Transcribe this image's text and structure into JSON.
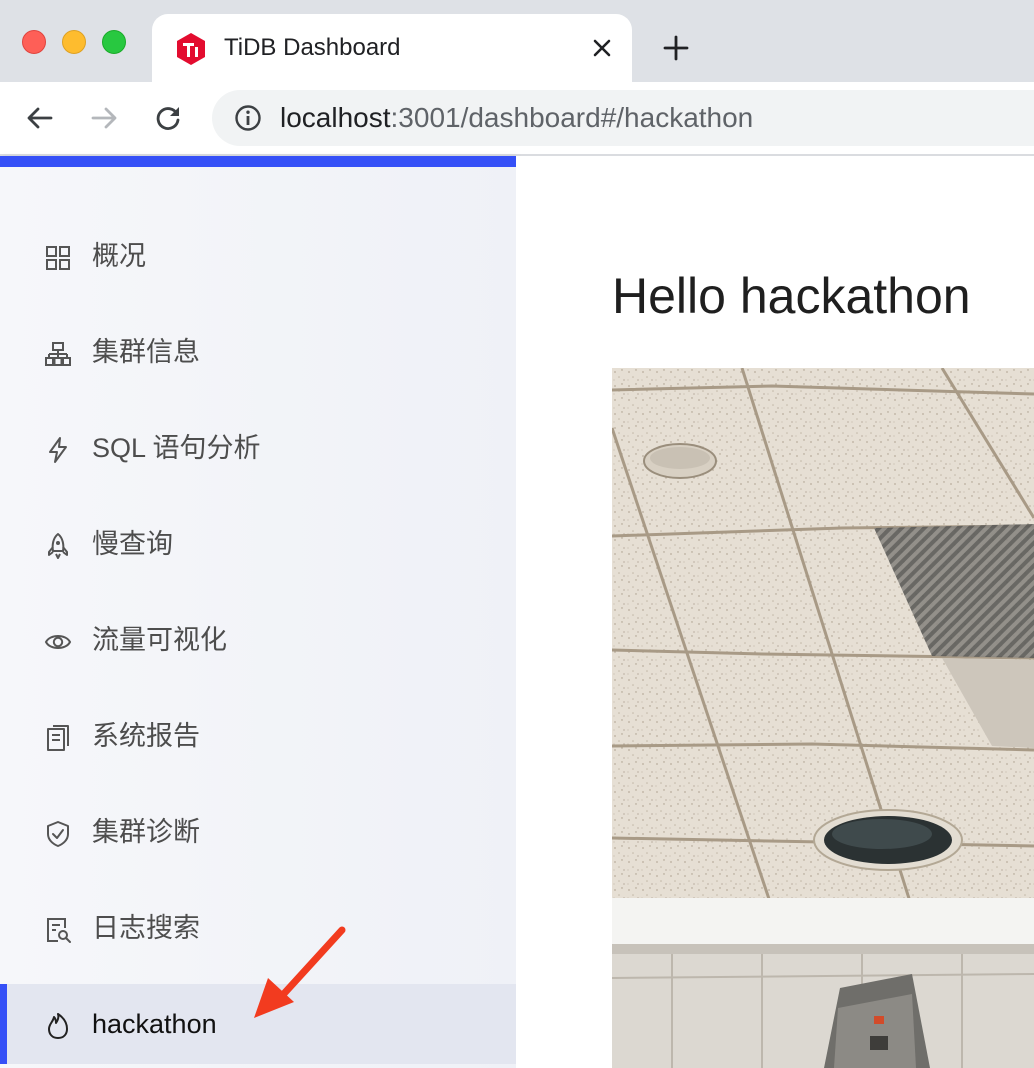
{
  "browser": {
    "tab_title": "TiDB Dashboard",
    "url_host": "localhost",
    "url_rest": ":3001/dashboard#/hackathon"
  },
  "sidebar": {
    "items": [
      {
        "label": "概况",
        "icon": "dashboard-grid-icon"
      },
      {
        "label": "集群信息",
        "icon": "cluster-icon"
      },
      {
        "label": "SQL 语句分析",
        "icon": "thunderbolt-icon"
      },
      {
        "label": "慢查询",
        "icon": "rocket-icon"
      },
      {
        "label": "流量可视化",
        "icon": "eye-icon"
      },
      {
        "label": "系统报告",
        "icon": "report-icon"
      },
      {
        "label": "集群诊断",
        "icon": "safety-shield-icon"
      },
      {
        "label": "日志搜索",
        "icon": "file-search-icon"
      },
      {
        "label": "hackathon",
        "icon": "fire-icon",
        "active": true
      }
    ]
  },
  "main": {
    "heading": "Hello hackathon"
  },
  "colors": {
    "accent": "#3550f7",
    "annotation_arrow": "#f23b1f"
  }
}
